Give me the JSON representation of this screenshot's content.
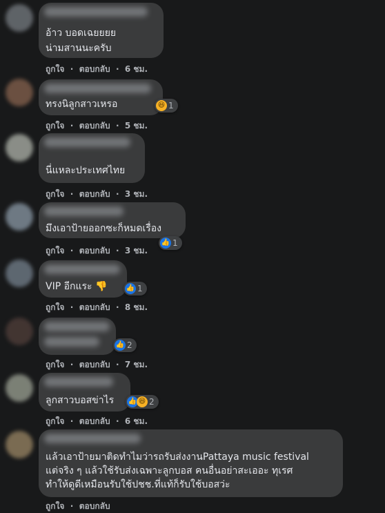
{
  "comments": [
    {
      "text_lines": [
        "อ้าว บอดเฉยยยย",
        "น่ามสานนะครับ"
      ],
      "like": "ถูกใจ",
      "reply": "ตอบกลับ",
      "time": "6 ชม.",
      "reaction_count": ""
    },
    {
      "text_lines": [
        "ทรงนิลูกสาวเหรอ"
      ],
      "like": "ถูกใจ",
      "reply": "ตอบกลับ",
      "time": "5 ชม.",
      "reaction_count": "1"
    },
    {
      "text_lines": [
        "นี่แหละประเทศไทย"
      ],
      "like": "ถูกใจ",
      "reply": "ตอบกลับ",
      "time": "3 ชม.",
      "reaction_count": ""
    },
    {
      "text_lines": [
        "มึงเอาป้ายออกซะก็หมดเรื่อง"
      ],
      "like": "ถูกใจ",
      "reply": "ตอบกลับ",
      "time": "3 ชม.",
      "reaction_count": "1"
    },
    {
      "text_lines": [
        "VIP อีกแระ 👎"
      ],
      "like": "ถูกใจ",
      "reply": "ตอบกลับ",
      "time": "8 ชม.",
      "reaction_count": "1"
    },
    {
      "text_lines": [
        ""
      ],
      "like": "ถูกใจ",
      "reply": "ตอบกลับ",
      "time": "7 ชม.",
      "reaction_count": "2"
    },
    {
      "text_lines": [
        "ลูกสาวบอสข่าไร"
      ],
      "like": "ถูกใจ",
      "reply": "ตอบกลับ",
      "time": "6 ชม.",
      "reaction_count": "2"
    },
    {
      "text_lines": [
        "แล้วเอาป้ายมาติดทำไมว่ารถรับส่งงานPattaya music festival",
        "แต่จริง ๆ แล้วใช้รับส่งเฉพาะลูกบอส คนอื่นอย่าสะเออะ ทุเรศ",
        "ทำให้ดูดีเหมือนรับใช้ปชช.ที่แท้ก็รับใช้บอสว่ะ"
      ],
      "like": "ถูกใจ",
      "reply": "ตอบกลับ",
      "time": "",
      "reaction_count": ""
    }
  ],
  "separator": "·",
  "icons": {
    "like": "thumbs-up-icon",
    "haha": "haha-face-icon"
  },
  "colors": {
    "background": "#18191a",
    "bubble": "#3a3b3c",
    "like_blue": "#1b74e4",
    "haha_yellow": "#f7b125"
  }
}
